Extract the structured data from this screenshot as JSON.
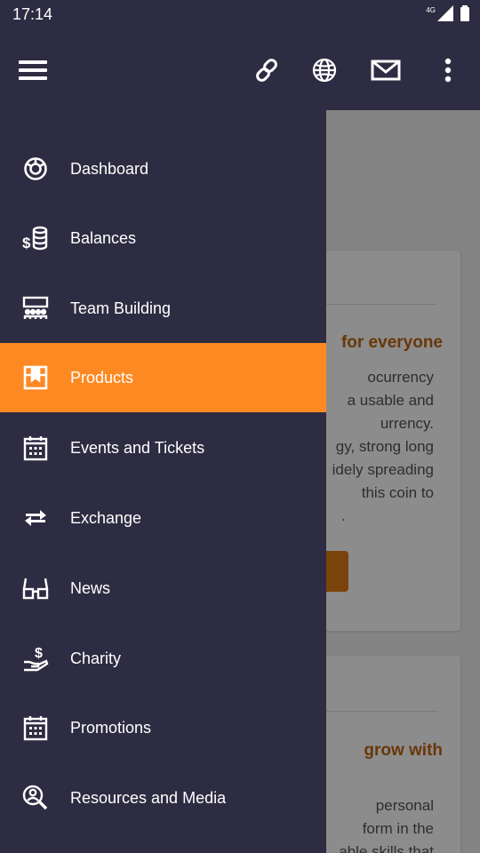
{
  "status_bar": {
    "time": "17:14",
    "network": "4G"
  },
  "app_bar": {
    "menu_icon": "hamburger-icon",
    "actions": [
      "link-icon",
      "globe-icon",
      "mail-icon",
      "more-vert-icon"
    ]
  },
  "drawer": {
    "active_index": 3,
    "items": [
      {
        "label": "Dashboard",
        "icon": "dashboard-icon"
      },
      {
        "label": "Balances",
        "icon": "coins-icon"
      },
      {
        "label": "Team Building",
        "icon": "team-icon"
      },
      {
        "label": "Products",
        "icon": "box-icon"
      },
      {
        "label": "Events and Tickets",
        "icon": "calendar-icon"
      },
      {
        "label": "Exchange",
        "icon": "exchange-icon"
      },
      {
        "label": "News",
        "icon": "glasses-icon"
      },
      {
        "label": "Charity",
        "icon": "charity-icon"
      },
      {
        "label": "Promotions",
        "icon": "calendar-icon"
      },
      {
        "label": "Resources and Media",
        "icon": "user-search-icon"
      }
    ]
  },
  "background": {
    "card1": {
      "title": "for everyone",
      "lines": [
        "ocurrency",
        "a usable and",
        "urrency.",
        "gy, strong long",
        "idely spreading",
        "this coin to",
        "."
      ]
    },
    "card2": {
      "title": "grow with",
      "lines": [
        "personal",
        "form in the",
        "able skills that"
      ]
    }
  },
  "colors": {
    "accent": "#fd8922",
    "drawer_bg": "#2d2c42",
    "title_orange": "#c0650f"
  }
}
